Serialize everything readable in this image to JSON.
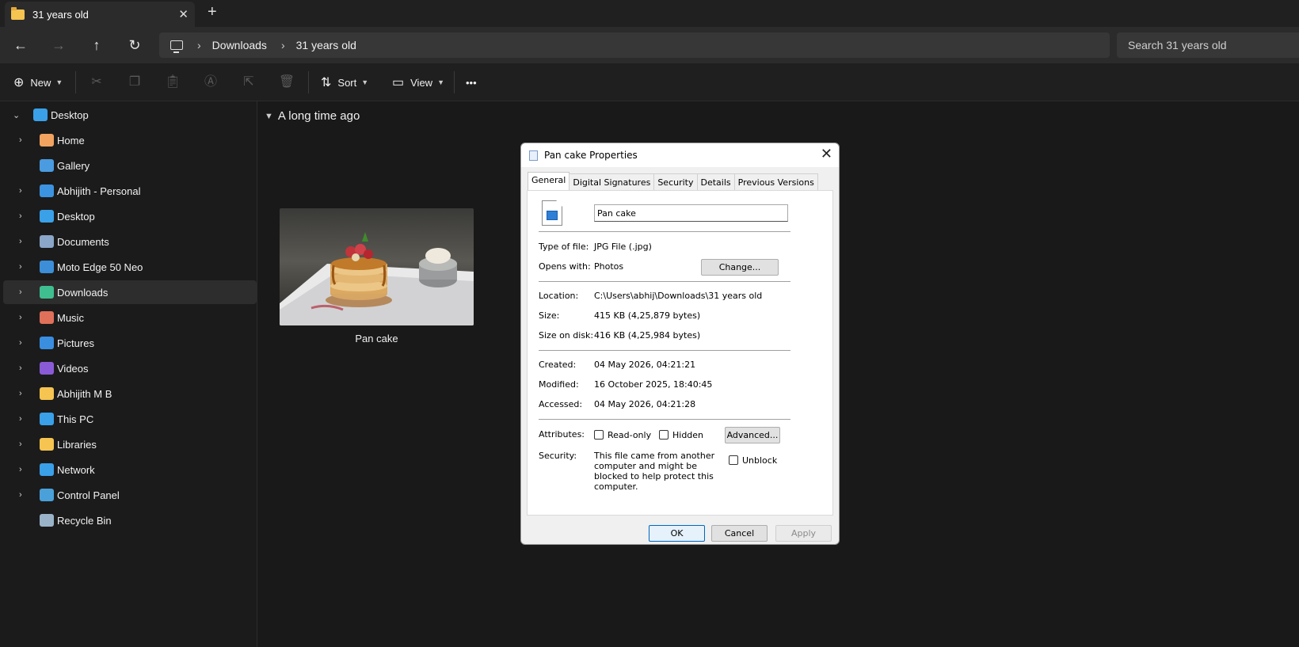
{
  "window": {
    "tab_title": "31 years old",
    "tab_close": "✕",
    "new_tab": "+"
  },
  "addressbar": {
    "back": "←",
    "forward": "→",
    "up": "↑",
    "refresh": "↻",
    "breadcrumbs": [
      "Downloads",
      "31 years old"
    ],
    "search_placeholder": "Search 31 years old"
  },
  "commandbar": {
    "new_label": "New",
    "sort_label": "Sort",
    "view_label": "View",
    "more": "•••"
  },
  "sidebar": {
    "items": [
      {
        "label": "Desktop",
        "icon": "desktop-icon",
        "color": "#3aa0e8",
        "expanded": true
      },
      {
        "label": "Home",
        "icon": "home-icon",
        "color": "#f2a35f"
      },
      {
        "label": "Gallery",
        "icon": "gallery-icon",
        "color": "#4a9be0"
      },
      {
        "label": "Abhijith - Personal",
        "icon": "onedrive-icon",
        "color": "#3c93e0"
      },
      {
        "label": "Desktop",
        "icon": "desktop-icon",
        "color": "#3aa0e8"
      },
      {
        "label": "Documents",
        "icon": "documents-icon",
        "color": "#8aa6c8"
      },
      {
        "label": "Moto Edge 50 Neo",
        "icon": "phone-icon",
        "color": "#3c8ed8"
      },
      {
        "label": "Downloads",
        "icon": "download-icon",
        "color": "#3fbf8f"
      },
      {
        "label": "Music",
        "icon": "music-icon",
        "color": "#e0705a"
      },
      {
        "label": "Pictures",
        "icon": "pictures-icon",
        "color": "#3a8ee0"
      },
      {
        "label": "Videos",
        "icon": "videos-icon",
        "color": "#8a5bd6"
      },
      {
        "label": "Abhijith M B",
        "icon": "folder-icon",
        "color": "#f5c451"
      },
      {
        "label": "This PC",
        "icon": "this-pc-icon",
        "color": "#3aa0e8"
      },
      {
        "label": "Libraries",
        "icon": "libraries-icon",
        "color": "#f5c451"
      },
      {
        "label": "Network",
        "icon": "network-icon",
        "color": "#3aa0e8"
      },
      {
        "label": "Control Panel",
        "icon": "control-panel-icon",
        "color": "#4aa0d8"
      },
      {
        "label": "Recycle Bin",
        "icon": "recycle-bin-icon",
        "color": "#9ab3c8"
      }
    ]
  },
  "content": {
    "group_header": "A long time ago",
    "file_name": "Pan cake"
  },
  "dialog": {
    "title": "Pan cake Properties",
    "tabs": [
      "General",
      "Digital Signatures",
      "Security",
      "Details",
      "Previous Versions"
    ],
    "name_value": "Pan cake",
    "type_label": "Type of file:",
    "type_value": "JPG File (.jpg)",
    "opens_label": "Opens with:",
    "opens_value": "Photos",
    "change_button": "Change...",
    "location_label": "Location:",
    "location_value": "C:\\Users\\abhij\\Downloads\\31 years old",
    "size_label": "Size:",
    "size_value": "415 KB (4,25,879 bytes)",
    "sizeondisk_label": "Size on disk:",
    "sizeondisk_value": "416 KB (4,25,984 bytes)",
    "created_label": "Created:",
    "created_value": "04 May 2026, 04:21:21",
    "modified_label": "Modified:",
    "modified_value": "16 October 2025, 18:40:45",
    "accessed_label": "Accessed:",
    "accessed_value": "04 May 2026, 04:21:28",
    "attributes_label": "Attributes:",
    "readonly_label": "Read-only",
    "hidden_label": "Hidden",
    "advanced_button": "Advanced...",
    "security_label": "Security:",
    "security_note": "This file came from another computer and might be blocked to help protect this computer.",
    "unblock_label": "Unblock",
    "ok_button": "OK",
    "cancel_button": "Cancel",
    "apply_button": "Apply"
  }
}
